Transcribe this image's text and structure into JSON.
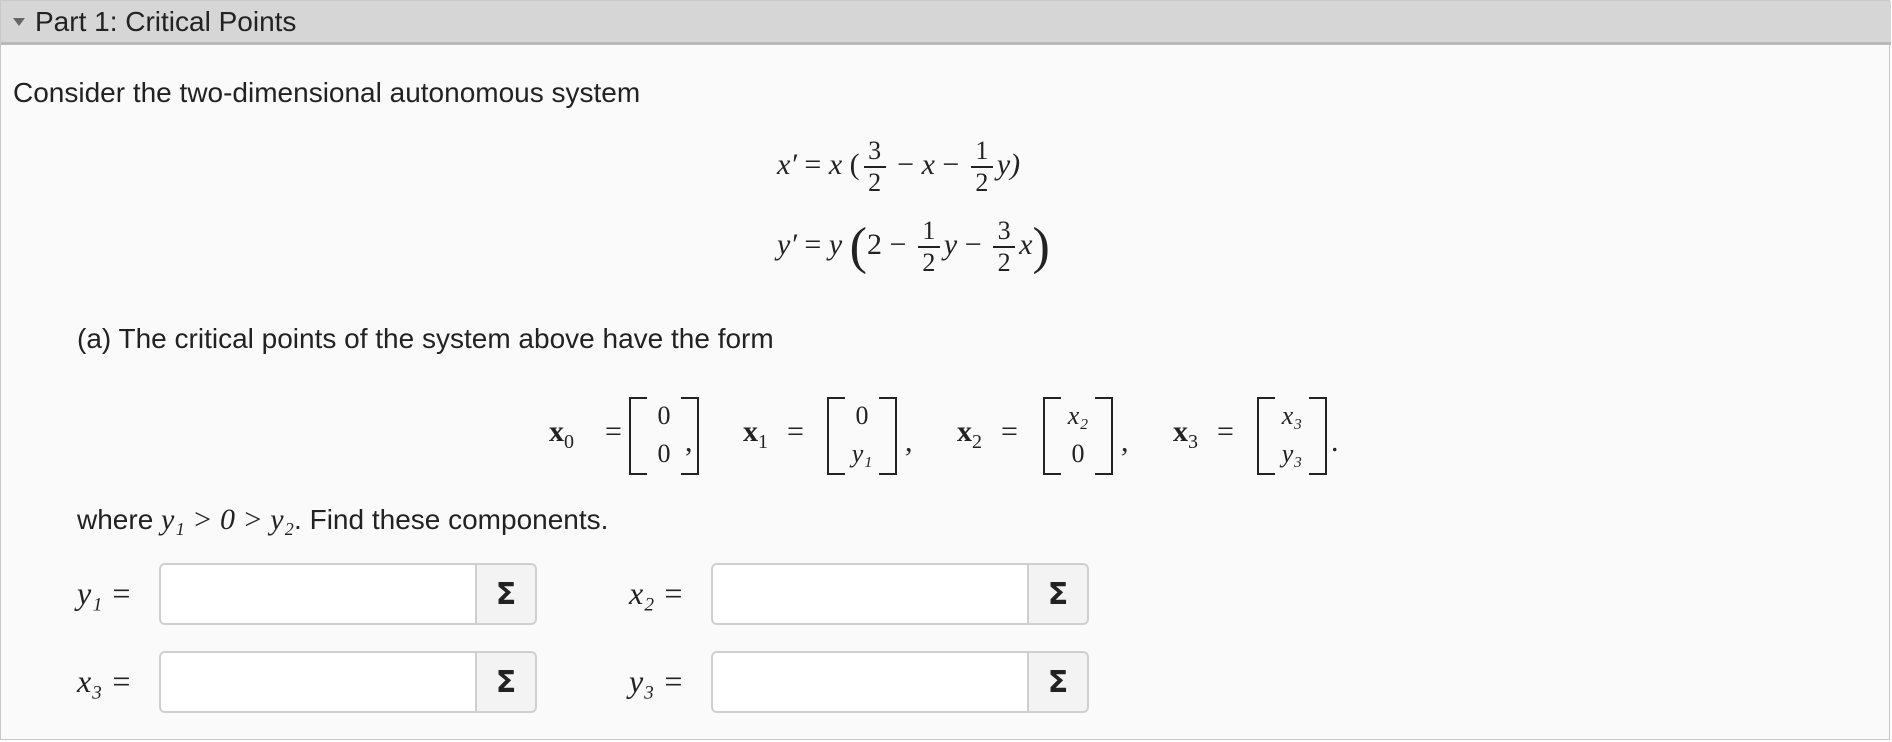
{
  "header": {
    "title": "Part 1: Critical Points"
  },
  "intro": "Consider the two-dimensional autonomous system",
  "system": {
    "eq1": {
      "lhs": "x′",
      "var": "x",
      "f1_num": "3",
      "f1_den": "2",
      "minus_x": "x",
      "f2_num": "1",
      "f2_den": "2",
      "tail": "y)"
    },
    "eq2": {
      "lhs": "y′",
      "var": "y",
      "two": "2",
      "f1_num": "1",
      "f1_den": "2",
      "mid": "y",
      "f2_num": "3",
      "f2_den": "2",
      "tail": "x"
    }
  },
  "question_a": "(a) The critical points of the system above have the form",
  "vectors": [
    {
      "name": "x",
      "sub": "0",
      "top": "0",
      "bottom": "0"
    },
    {
      "name": "x",
      "sub": "1",
      "top": "0",
      "bottom": "y₁"
    },
    {
      "name": "x",
      "sub": "2",
      "top": "x₂",
      "bottom": "0"
    },
    {
      "name": "x",
      "sub": "3",
      "top": "x₃",
      "bottom": "y₃"
    }
  ],
  "where_text": {
    "prefix": "where",
    "cond": "y₁ > 0 > y₂",
    "suffix": ". Find these components."
  },
  "inputs": [
    {
      "label": "y₁ =",
      "value": "",
      "button": "Σ"
    },
    {
      "label": "x₂ =",
      "value": "",
      "button": "Σ"
    },
    {
      "label": "x₃ =",
      "value": "",
      "button": "Σ"
    },
    {
      "label": "y₃ =",
      "value": "",
      "button": "Σ"
    }
  ]
}
